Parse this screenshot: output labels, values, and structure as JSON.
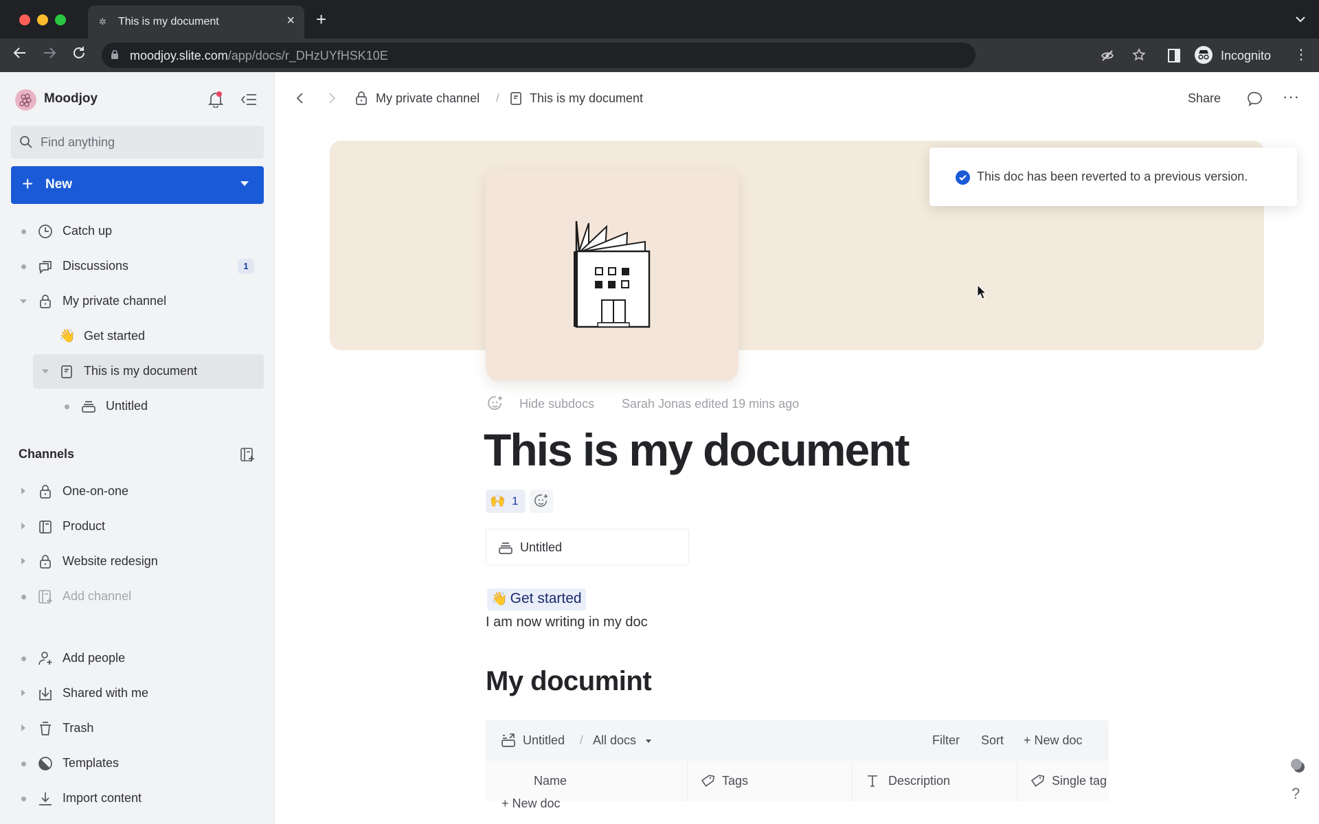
{
  "browser": {
    "tab_title": "This is my document",
    "url_host": "moodjoy.slite.com",
    "url_path": "/app/docs/r_DHzUYfHSK10E",
    "profile_label": "Incognito",
    "colors": {
      "close": "#ff5f57",
      "minimize": "#febc2e",
      "maximize": "#28c840"
    }
  },
  "sidebar": {
    "workspace_name": "Moodjoy",
    "search_placeholder": "Find anything",
    "new_button_label": "New",
    "top_items": [
      {
        "label": "Catch up",
        "icon": "clock-icon"
      },
      {
        "label": "Discussions",
        "icon": "chat-bubbles-icon",
        "badge": "1"
      },
      {
        "label": "My private channel",
        "icon": "lock-icon",
        "expanded": true
      }
    ],
    "private_channel_children": [
      {
        "label": "Get started",
        "icon": "👋"
      },
      {
        "label": "This is my document",
        "icon": "document-icon",
        "active": true,
        "expanded": true
      }
    ],
    "document_children": [
      {
        "label": "Untitled",
        "icon": "collection-icon"
      }
    ],
    "channels_heading": "Channels",
    "channels": [
      {
        "label": "One-on-one",
        "icon": "lock-icon"
      },
      {
        "label": "Product",
        "icon": "channel-icon"
      },
      {
        "label": "Website redesign",
        "icon": "lock-icon"
      },
      {
        "label": "Add channel",
        "icon": "add-channel-icon",
        "muted": true
      }
    ],
    "bottom_items": [
      {
        "label": "Add people",
        "icon": "add-person-icon"
      },
      {
        "label": "Shared with me",
        "icon": "inbox-download-icon"
      },
      {
        "label": "Trash",
        "icon": "trash-icon"
      },
      {
        "label": "Templates",
        "icon": "templates-icon"
      },
      {
        "label": "Import content",
        "icon": "import-icon"
      }
    ]
  },
  "header": {
    "breadcrumb": [
      "My private channel",
      "This is my document"
    ],
    "breadcrumb_separator": "/",
    "share_label": "Share"
  },
  "toast": {
    "message": "This doc has been reverted to a previous version."
  },
  "doc": {
    "hide_subdocs_label": "Hide subdocs",
    "edited_text": "Sarah Jonas edited 19 mins ago",
    "title": "This is my document",
    "reaction": {
      "emoji": "🙌",
      "count": "1"
    },
    "subdoc_card_label": "Untitled",
    "mention": {
      "emoji": "👋",
      "label": "Get started"
    },
    "body_text": "I am now writing in my doc",
    "heading2": "My documint",
    "collection": {
      "name": "Untitled",
      "separator": "/",
      "view": "All docs",
      "filter_label": "Filter",
      "sort_label": "Sort",
      "new_doc_label": "+ New doc",
      "columns": [
        {
          "label": "Name"
        },
        {
          "label": "Tags",
          "icon": "tag-icon"
        },
        {
          "label": "Description",
          "icon": "text-icon"
        },
        {
          "label": "Single tag",
          "icon": "tag-icon"
        }
      ],
      "add_row_label": "+ New doc"
    }
  },
  "accent_color": "#1a5ad7"
}
